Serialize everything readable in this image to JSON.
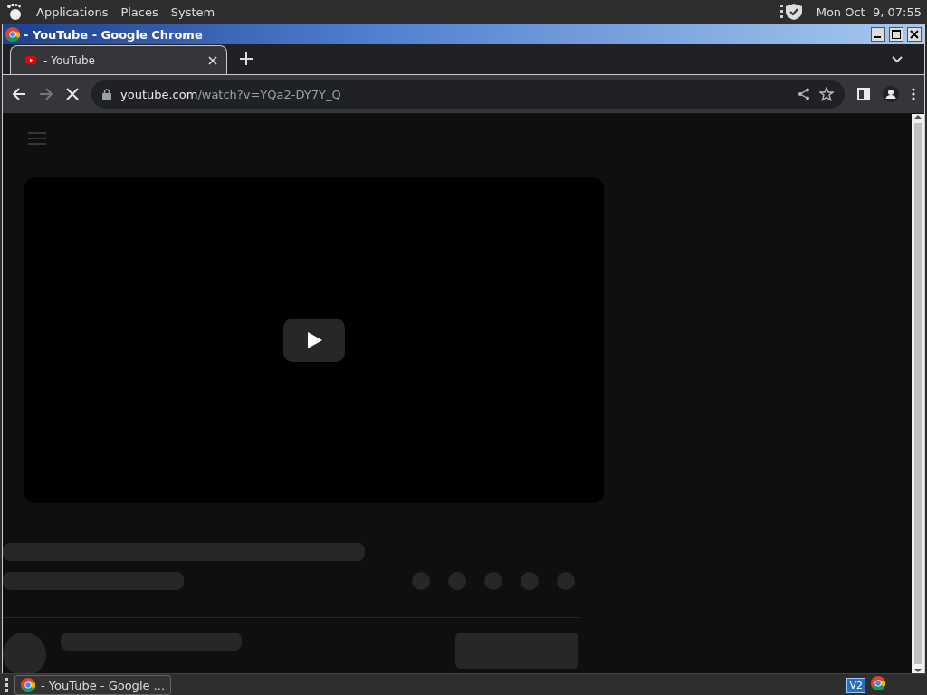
{
  "top_panel": {
    "menus": [
      "Applications",
      "Places",
      "System"
    ],
    "clock": "Mon Oct  9, 07:55"
  },
  "window": {
    "title": "- YouTube - Google Chrome"
  },
  "tabs": [
    {
      "label": "- YouTube",
      "selected": true
    }
  ],
  "address": {
    "host": "youtube.com",
    "path": "/watch?v=YQa2-DY7Y_Q"
  },
  "taskbar": {
    "items": [
      {
        "label": "- YouTube - Google ..."
      }
    ],
    "tray_label": "V2"
  }
}
